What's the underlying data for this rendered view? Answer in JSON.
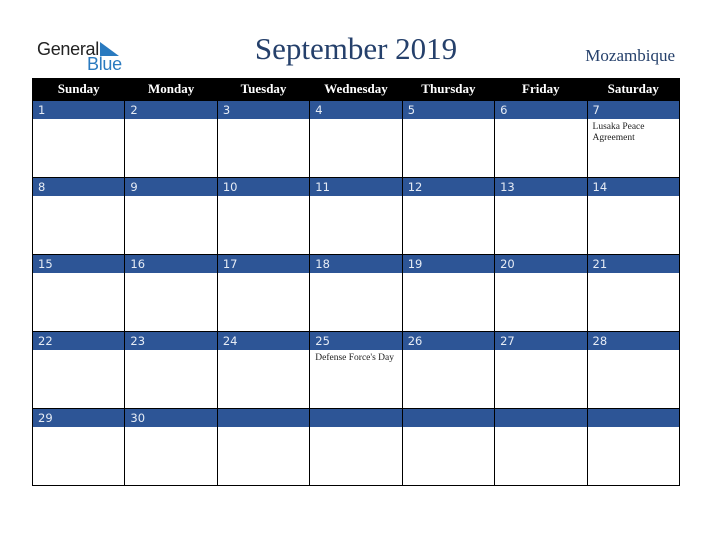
{
  "logo": {
    "word1": "General",
    "word2": "Blue"
  },
  "header": {
    "title": "September 2019",
    "country": "Mozambique"
  },
  "colors": {
    "band": "#2d5596",
    "title": "#25406b",
    "logo_blue": "#2a7abf"
  },
  "weekdays": [
    "Sunday",
    "Monday",
    "Tuesday",
    "Wednesday",
    "Thursday",
    "Friday",
    "Saturday"
  ],
  "weeks": [
    [
      {
        "day": "1",
        "event": ""
      },
      {
        "day": "2",
        "event": ""
      },
      {
        "day": "3",
        "event": ""
      },
      {
        "day": "4",
        "event": ""
      },
      {
        "day": "5",
        "event": ""
      },
      {
        "day": "6",
        "event": ""
      },
      {
        "day": "7",
        "event": "Lusaka Peace Agreement"
      }
    ],
    [
      {
        "day": "8",
        "event": ""
      },
      {
        "day": "9",
        "event": ""
      },
      {
        "day": "10",
        "event": ""
      },
      {
        "day": "11",
        "event": ""
      },
      {
        "day": "12",
        "event": ""
      },
      {
        "day": "13",
        "event": ""
      },
      {
        "day": "14",
        "event": ""
      }
    ],
    [
      {
        "day": "15",
        "event": ""
      },
      {
        "day": "16",
        "event": ""
      },
      {
        "day": "17",
        "event": ""
      },
      {
        "day": "18",
        "event": ""
      },
      {
        "day": "19",
        "event": ""
      },
      {
        "day": "20",
        "event": ""
      },
      {
        "day": "21",
        "event": ""
      }
    ],
    [
      {
        "day": "22",
        "event": ""
      },
      {
        "day": "23",
        "event": ""
      },
      {
        "day": "24",
        "event": ""
      },
      {
        "day": "25",
        "event": "Defense Force's Day"
      },
      {
        "day": "26",
        "event": ""
      },
      {
        "day": "27",
        "event": ""
      },
      {
        "day": "28",
        "event": ""
      }
    ],
    [
      {
        "day": "29",
        "event": ""
      },
      {
        "day": "30",
        "event": ""
      },
      {
        "day": "",
        "event": ""
      },
      {
        "day": "",
        "event": ""
      },
      {
        "day": "",
        "event": ""
      },
      {
        "day": "",
        "event": ""
      },
      {
        "day": "",
        "event": ""
      }
    ]
  ]
}
